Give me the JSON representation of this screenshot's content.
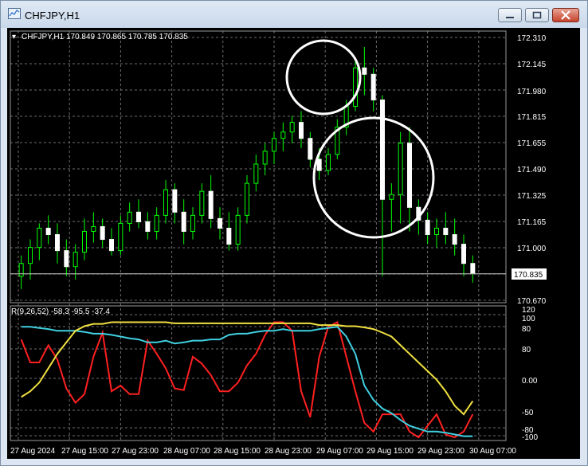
{
  "window": {
    "title": "CHFJPY,H1",
    "buttons": {
      "minimize": "minimize",
      "maximize": "maximize",
      "close": "close"
    }
  },
  "colors": {
    "background": "#000000",
    "grid": "#6e6e6e",
    "bull_candle": "#00ff00",
    "bear_candle": "#ffffff",
    "red_line": "#ff2020",
    "cyan_line": "#40d0e0",
    "yellow_line": "#f0e040",
    "annotation_circle": "#ffffff"
  },
  "main_chart": {
    "header": "CHFJPY,H1  170.849 170.865 170.785 170.835",
    "current_price_label": "170.835",
    "y_ticks": [
      "172.310",
      "172.145",
      "171.980",
      "171.815",
      "171.655",
      "171.490",
      "171.325",
      "171.165",
      "171.000",
      "170.835",
      "170.670"
    ]
  },
  "indicator": {
    "header": "R(9,26,52) -58.3 -95.5 -37.4",
    "y_ticks": [
      "120",
      "100",
      "80",
      "80",
      "0.00",
      "-50",
      "-80",
      "-100"
    ]
  },
  "x_axis": {
    "labels": [
      "27 Aug 2024",
      "27 Aug 15:00",
      "27 Aug 23:00",
      "28 Aug 07:00",
      "28 Aug 15:00",
      "28 Aug 23:00",
      "29 Aug 07:00",
      "29 Aug 15:00",
      "29 Aug 23:00",
      "30 Aug 07:00"
    ]
  },
  "chart_data": [
    {
      "type": "candlestick",
      "title": "CHFJPY,H1",
      "ylim": [
        170.67,
        172.31
      ],
      "candles_ohlc": [
        [
          170.82,
          170.95,
          170.74,
          170.9
        ],
        [
          170.9,
          171.05,
          170.8,
          171.0
        ],
        [
          171.0,
          171.15,
          170.92,
          171.12
        ],
        [
          171.12,
          171.2,
          171.02,
          171.08
        ],
        [
          171.08,
          171.15,
          170.9,
          170.98
        ],
        [
          170.98,
          171.05,
          170.82,
          170.88
        ],
        [
          170.88,
          171.02,
          170.8,
          170.97
        ],
        [
          170.97,
          171.18,
          170.92,
          171.1
        ],
        [
          171.1,
          171.22,
          171.03,
          171.13
        ],
        [
          171.13,
          171.18,
          171.0,
          171.05
        ],
        [
          171.05,
          171.12,
          170.95,
          170.98
        ],
        [
          170.98,
          171.2,
          170.95,
          171.15
        ],
        [
          171.15,
          171.28,
          171.1,
          171.22
        ],
        [
          171.22,
          171.3,
          171.12,
          171.16
        ],
        [
          171.16,
          171.22,
          171.05,
          171.1
        ],
        [
          171.1,
          171.25,
          171.05,
          171.2
        ],
        [
          171.2,
          171.42,
          171.15,
          171.36
        ],
        [
          171.36,
          171.4,
          171.15,
          171.22
        ],
        [
          171.22,
          171.3,
          171.02,
          171.1
        ],
        [
          171.1,
          171.25,
          171.05,
          171.2
        ],
        [
          171.2,
          171.4,
          171.15,
          171.35
        ],
        [
          171.35,
          171.45,
          171.12,
          171.18
        ],
        [
          171.18,
          171.25,
          171.05,
          171.12
        ],
        [
          171.12,
          171.22,
          170.98,
          171.02
        ],
        [
          171.02,
          171.25,
          170.98,
          171.2
        ],
        [
          171.2,
          171.45,
          171.15,
          171.4
        ],
        [
          171.4,
          171.58,
          171.35,
          171.52
        ],
        [
          171.52,
          171.65,
          171.45,
          171.6
        ],
        [
          171.6,
          171.72,
          171.52,
          171.68
        ],
        [
          171.68,
          171.78,
          171.6,
          171.72
        ],
        [
          171.72,
          171.82,
          171.65,
          171.78
        ],
        [
          171.78,
          171.85,
          171.62,
          171.68
        ],
        [
          171.68,
          171.72,
          171.5,
          171.55
        ],
        [
          171.55,
          171.62,
          171.42,
          171.48
        ],
        [
          171.48,
          171.62,
          171.45,
          171.58
        ],
        [
          171.58,
          171.8,
          171.55,
          171.75
        ],
        [
          171.75,
          171.92,
          171.7,
          171.88
        ],
        [
          171.88,
          172.18,
          171.85,
          172.12
        ],
        [
          172.12,
          172.25,
          171.95,
          172.08
        ],
        [
          172.08,
          172.12,
          171.85,
          171.92
        ],
        [
          171.92,
          171.95,
          170.82,
          171.3
        ],
        [
          171.3,
          171.4,
          171.1,
          171.33
        ],
        [
          171.33,
          171.72,
          171.15,
          171.65
        ],
        [
          171.65,
          171.75,
          171.1,
          171.25
        ],
        [
          171.25,
          171.3,
          171.08,
          171.17
        ],
        [
          171.17,
          171.22,
          171.02,
          171.08
        ],
        [
          171.08,
          171.18,
          171.0,
          171.12
        ],
        [
          171.12,
          171.22,
          171.02,
          171.08
        ],
        [
          171.08,
          171.18,
          170.95,
          171.02
        ],
        [
          171.02,
          171.08,
          170.82,
          170.9
        ],
        [
          170.9,
          170.95,
          170.78,
          170.84
        ]
      ]
    },
    {
      "type": "line",
      "title": "R(9,26,52)",
      "ylim": [
        -100,
        120
      ],
      "y_ticks": [
        120,
        100,
        80,
        0,
        -50,
        -80,
        -100
      ],
      "series": [
        {
          "name": "R(9)",
          "values": [
            70,
            30,
            30,
            60,
            35,
            -15,
            -40,
            -25,
            40,
            82,
            -20,
            -10,
            -25,
            -25,
            68,
            45,
            20,
            -15,
            -18,
            40,
            28,
            8,
            -20,
            -20,
            -5,
            25,
            45,
            78,
            100,
            100,
            85,
            -20,
            -65,
            40,
            92,
            100,
            40,
            -20,
            -75,
            -90,
            -60,
            -60,
            -60,
            -90,
            -100,
            -80,
            -60,
            -95,
            -100,
            -90,
            -60
          ]
        },
        {
          "name": "R(26)",
          "values": [
            92,
            92,
            90,
            88,
            85,
            85,
            85,
            83,
            80,
            80,
            78,
            75,
            72,
            70,
            65,
            65,
            68,
            63,
            65,
            68,
            68,
            70,
            70,
            78,
            80,
            80,
            83,
            85,
            85,
            88,
            85,
            85,
            85,
            88,
            90,
            92,
            75,
            45,
            -10,
            -35,
            -50,
            -58,
            -70,
            -80,
            -85,
            -90,
            -90,
            -92,
            -95,
            -98,
            -98
          ]
        },
        {
          "name": "R(52)",
          "values": [
            -30,
            -20,
            -5,
            20,
            45,
            65,
            85,
            93,
            97,
            97,
            100,
            100,
            100,
            100,
            100,
            100,
            100,
            98,
            98,
            98,
            98,
            98,
            98,
            98,
            98,
            98,
            98,
            98,
            98,
            98,
            98,
            98,
            98,
            95,
            95,
            95,
            93,
            93,
            91,
            88,
            82,
            75,
            60,
            45,
            30,
            15,
            0,
            -20,
            -45,
            -60,
            -37
          ]
        }
      ]
    }
  ]
}
